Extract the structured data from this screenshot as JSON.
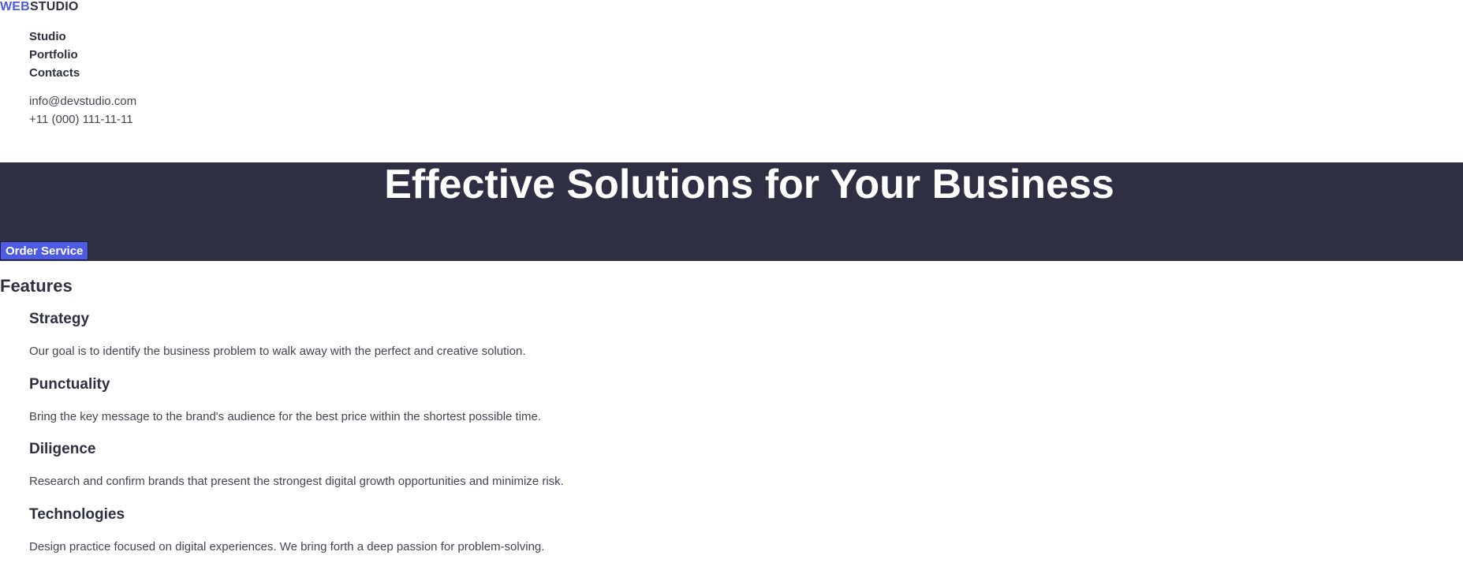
{
  "header": {
    "logo": {
      "part1": "WEB",
      "part2": "STUDIO"
    },
    "nav": [
      {
        "label": "Studio"
      },
      {
        "label": "Portfolio"
      },
      {
        "label": "Contacts"
      }
    ],
    "contacts": {
      "email": "info@devstudio.com",
      "phone": "+11 (000) 111-11-11"
    }
  },
  "hero": {
    "title": "Effective Solutions for Your Business",
    "button_label": "Order Service"
  },
  "features": {
    "title": "Features",
    "items": [
      {
        "name": "Strategy",
        "text": "Our goal is to identify the business problem to walk away with the perfect and creative solution."
      },
      {
        "name": "Punctuality",
        "text": "Bring the key message to the brand's audience for the best price within the shortest possible time."
      },
      {
        "name": "Diligence",
        "text": "Research and confirm brands that present the strongest digital growth opportunities and minimize risk."
      },
      {
        "name": "Technologies",
        "text": "Design practice focused on digital experiences. We bring forth a deep passion for problem-solving."
      }
    ]
  },
  "colors": {
    "accent": "#4d5ae5",
    "dark": "#2e2f42",
    "text": "#434455"
  }
}
